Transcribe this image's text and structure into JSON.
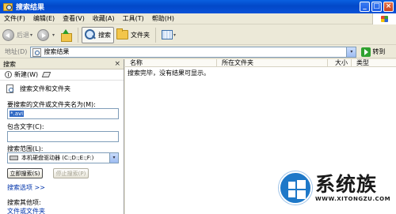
{
  "window": {
    "title": "搜索结果"
  },
  "window_buttons": {
    "minimize": "_",
    "maximize": "□",
    "close": "×"
  },
  "menu": [
    "文件(F)",
    "编辑(E)",
    "查看(V)",
    "收藏(A)",
    "工具(T)",
    "帮助(H)"
  ],
  "toolbar": {
    "back": "后退",
    "search": "搜索",
    "folders": "文件夹",
    "dropdown": "▾"
  },
  "address": {
    "label": "地址(D)",
    "value": "搜索结果",
    "go": "转到",
    "dropdown": "▾"
  },
  "search_pane": {
    "title": "搜索",
    "close": "×",
    "new_label": "新建(W)",
    "section_title": "搜索文件和文件夹",
    "name_label": "要搜索的文件或文件夹名为(M):",
    "name_value": "*.avi",
    "contains_label": "包含文字(C):",
    "contains_value": "",
    "look_in_label": "搜索范围(L):",
    "look_in_value": "本机硬盘驱动器 (C:;D:;E:;F:)",
    "search_now": "立即搜索(S)",
    "stop": "停止搜索(P)",
    "options_link": "搜索选项 >>",
    "other_label": "搜索其他项:",
    "other_link": "文件或文件夹"
  },
  "results": {
    "columns": [
      "名称",
      "所在文件夹",
      "大小",
      "类型"
    ],
    "message": "搜索完毕，没有结果可显示。"
  },
  "watermark": {
    "brand": "系统族",
    "url": "WWW.XITONGZU.COM"
  }
}
